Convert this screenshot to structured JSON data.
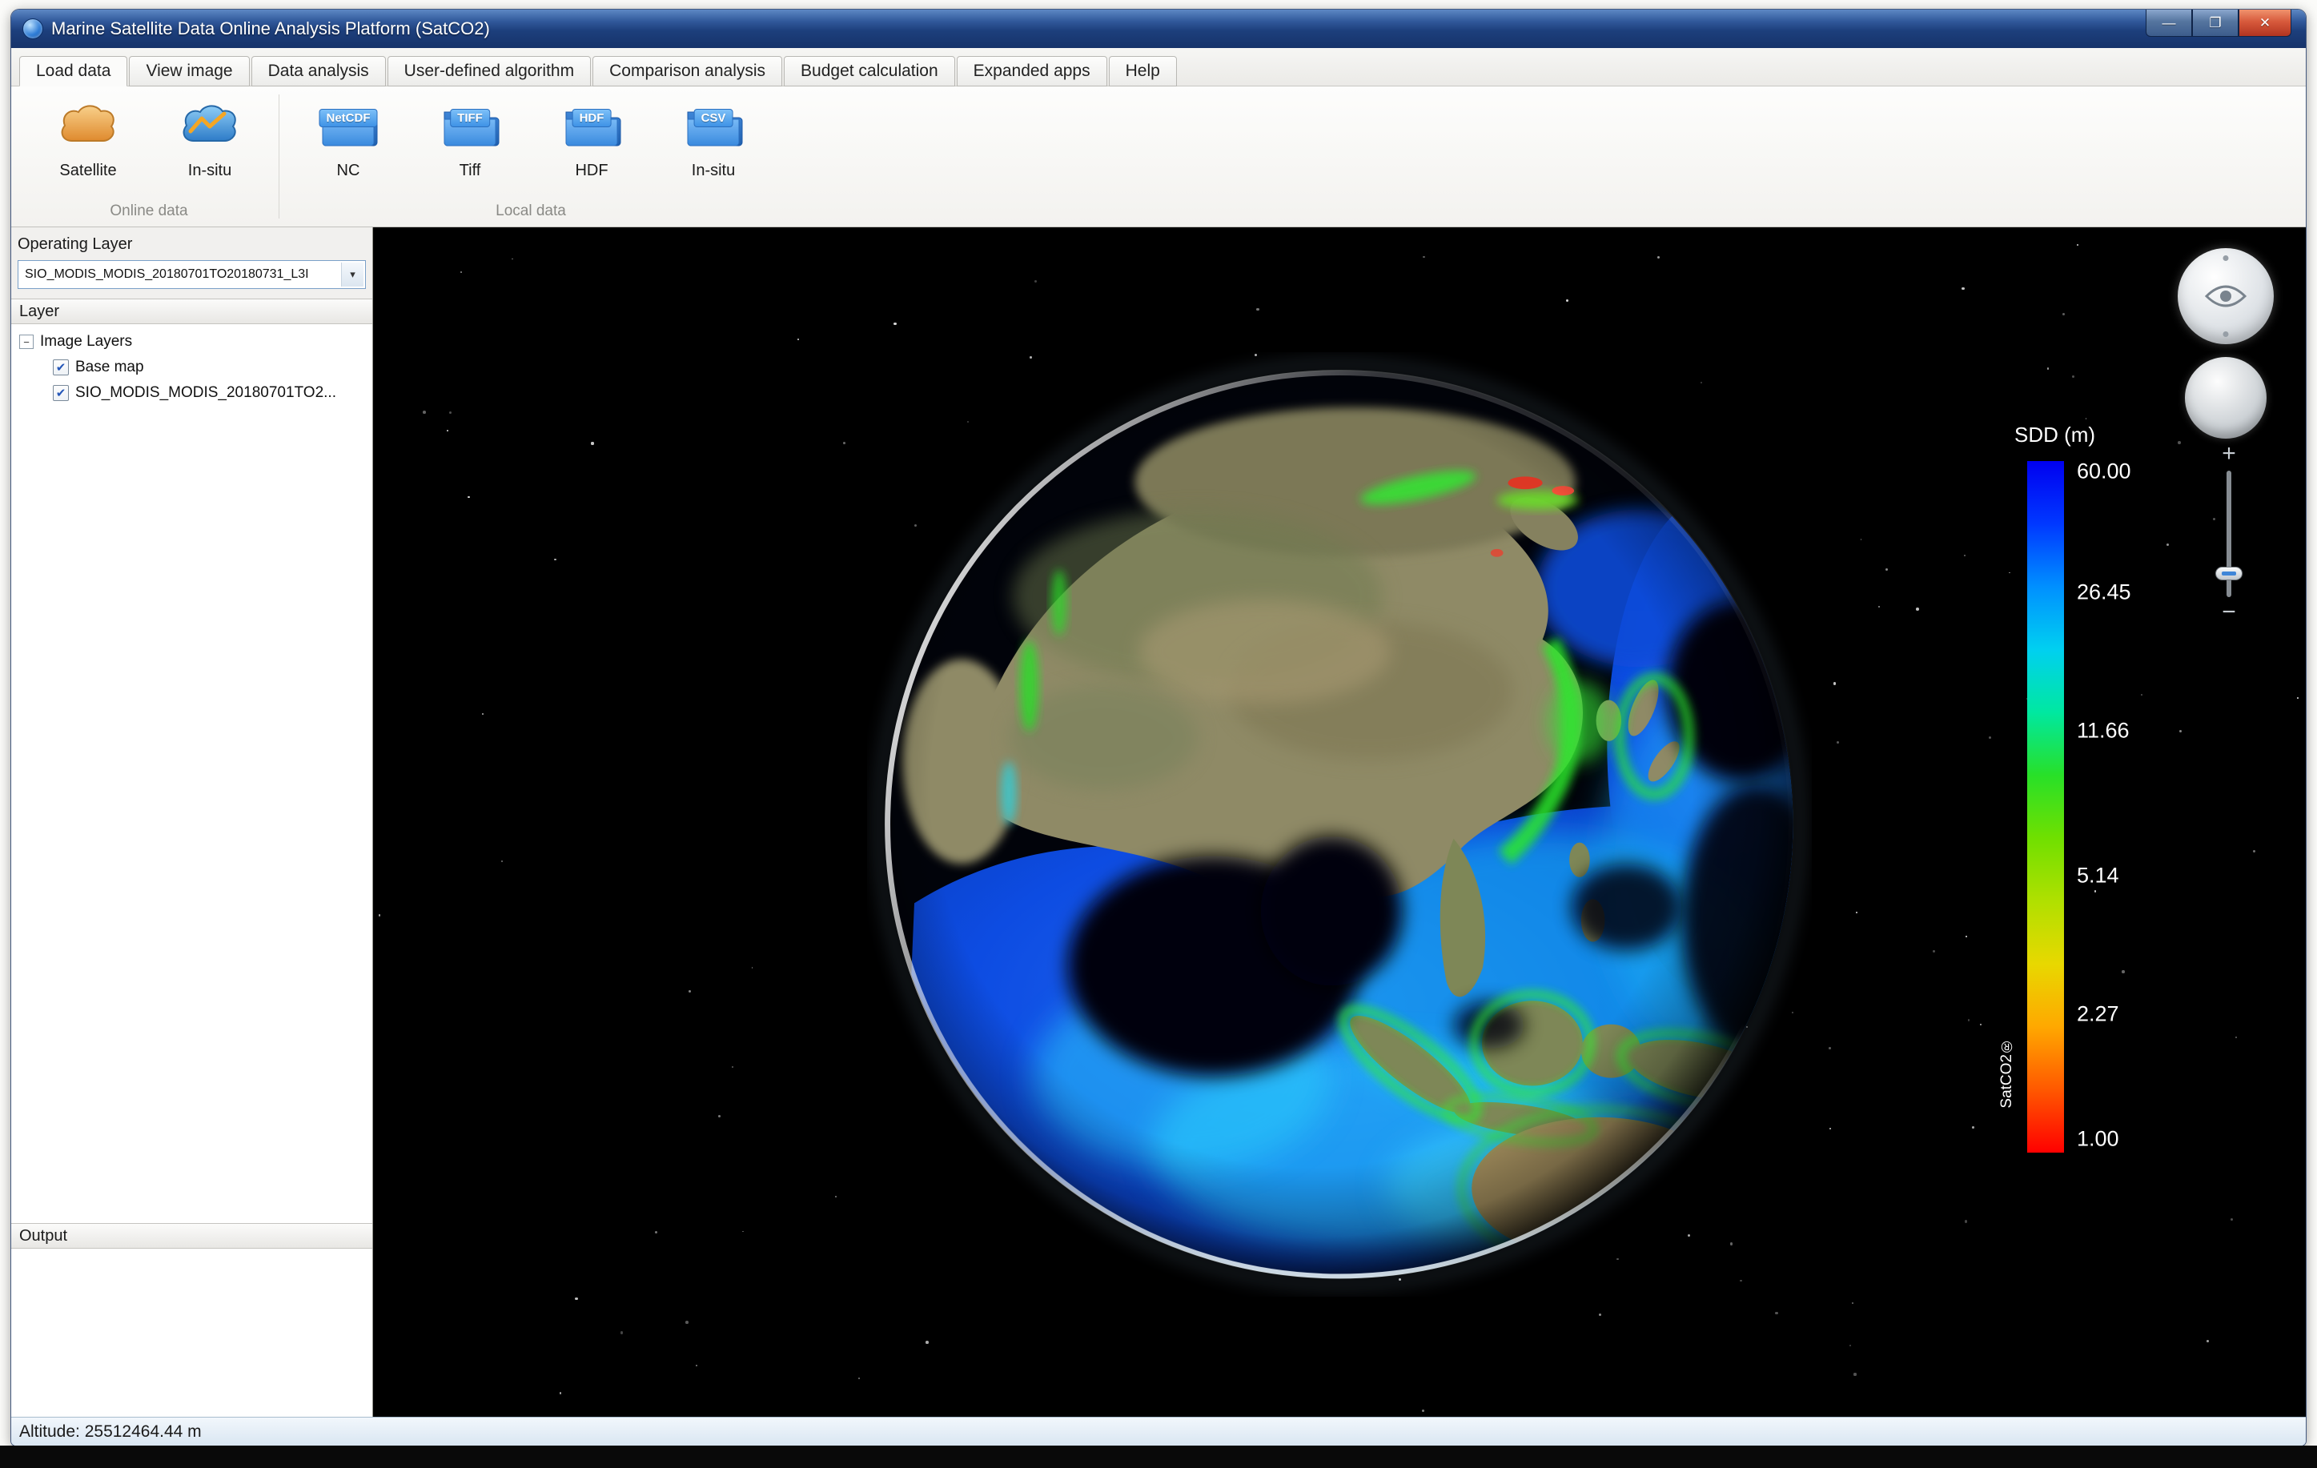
{
  "window": {
    "title": "Marine Satellite Data Online Analysis Platform (SatCO2)",
    "controls": {
      "minimize": "—",
      "maximize": "❐",
      "close": "✕"
    }
  },
  "tabs": [
    {
      "label": "Load data",
      "active": true
    },
    {
      "label": "View image"
    },
    {
      "label": "Data analysis"
    },
    {
      "label": "User-defined algorithm"
    },
    {
      "label": "Comparison analysis"
    },
    {
      "label": "Budget calculation"
    },
    {
      "label": "Expanded apps"
    },
    {
      "label": "Help"
    }
  ],
  "ribbon": {
    "items": [
      {
        "label": "Satellite"
      },
      {
        "label": "In-situ"
      },
      {
        "label": "NC",
        "badge": "NetCDF"
      },
      {
        "label": "Tiff",
        "badge": "TIFF"
      },
      {
        "label": "HDF",
        "badge": "HDF"
      },
      {
        "label": "In-situ",
        "badge": "CSV"
      }
    ],
    "groups": [
      {
        "label": "Online data"
      },
      {
        "label": "Local data"
      }
    ]
  },
  "sidebar": {
    "operating_layer_label": "Operating Layer",
    "operating_layer_value": "SIO_MODIS_MODIS_20180701TO20180731_L3I",
    "layer_panel_title": "Layer",
    "tree_root": "Image Layers",
    "tree_items": [
      {
        "label": "Base map",
        "checked": true
      },
      {
        "label": "SIO_MODIS_MODIS_20180701TO2...",
        "checked": true
      }
    ],
    "output_panel_title": "Output"
  },
  "legend": {
    "title": "SDD (m)",
    "brand": "SatCO2®",
    "ticks": [
      {
        "label": "60.00",
        "pct": 1.5
      },
      {
        "label": "26.45",
        "pct": 19
      },
      {
        "label": "11.66",
        "pct": 39
      },
      {
        "label": "5.14",
        "pct": 60
      },
      {
        "label": "2.27",
        "pct": 80
      },
      {
        "label": "1.00",
        "pct": 98
      }
    ],
    "gradient": [
      "#0000f0",
      "#0038ff",
      "#0090ff",
      "#00d0f0",
      "#00e8a0",
      "#28e028",
      "#70e000",
      "#b0e000",
      "#e8d800",
      "#ffa800",
      "#ff5800",
      "#ff0000"
    ]
  },
  "icons": {
    "check": "✔",
    "expander": "−",
    "dropdown": "▾",
    "plus": "+",
    "minus": "−"
  },
  "statusbar": {
    "altitude": "Altitude: 25512464.44 m"
  }
}
